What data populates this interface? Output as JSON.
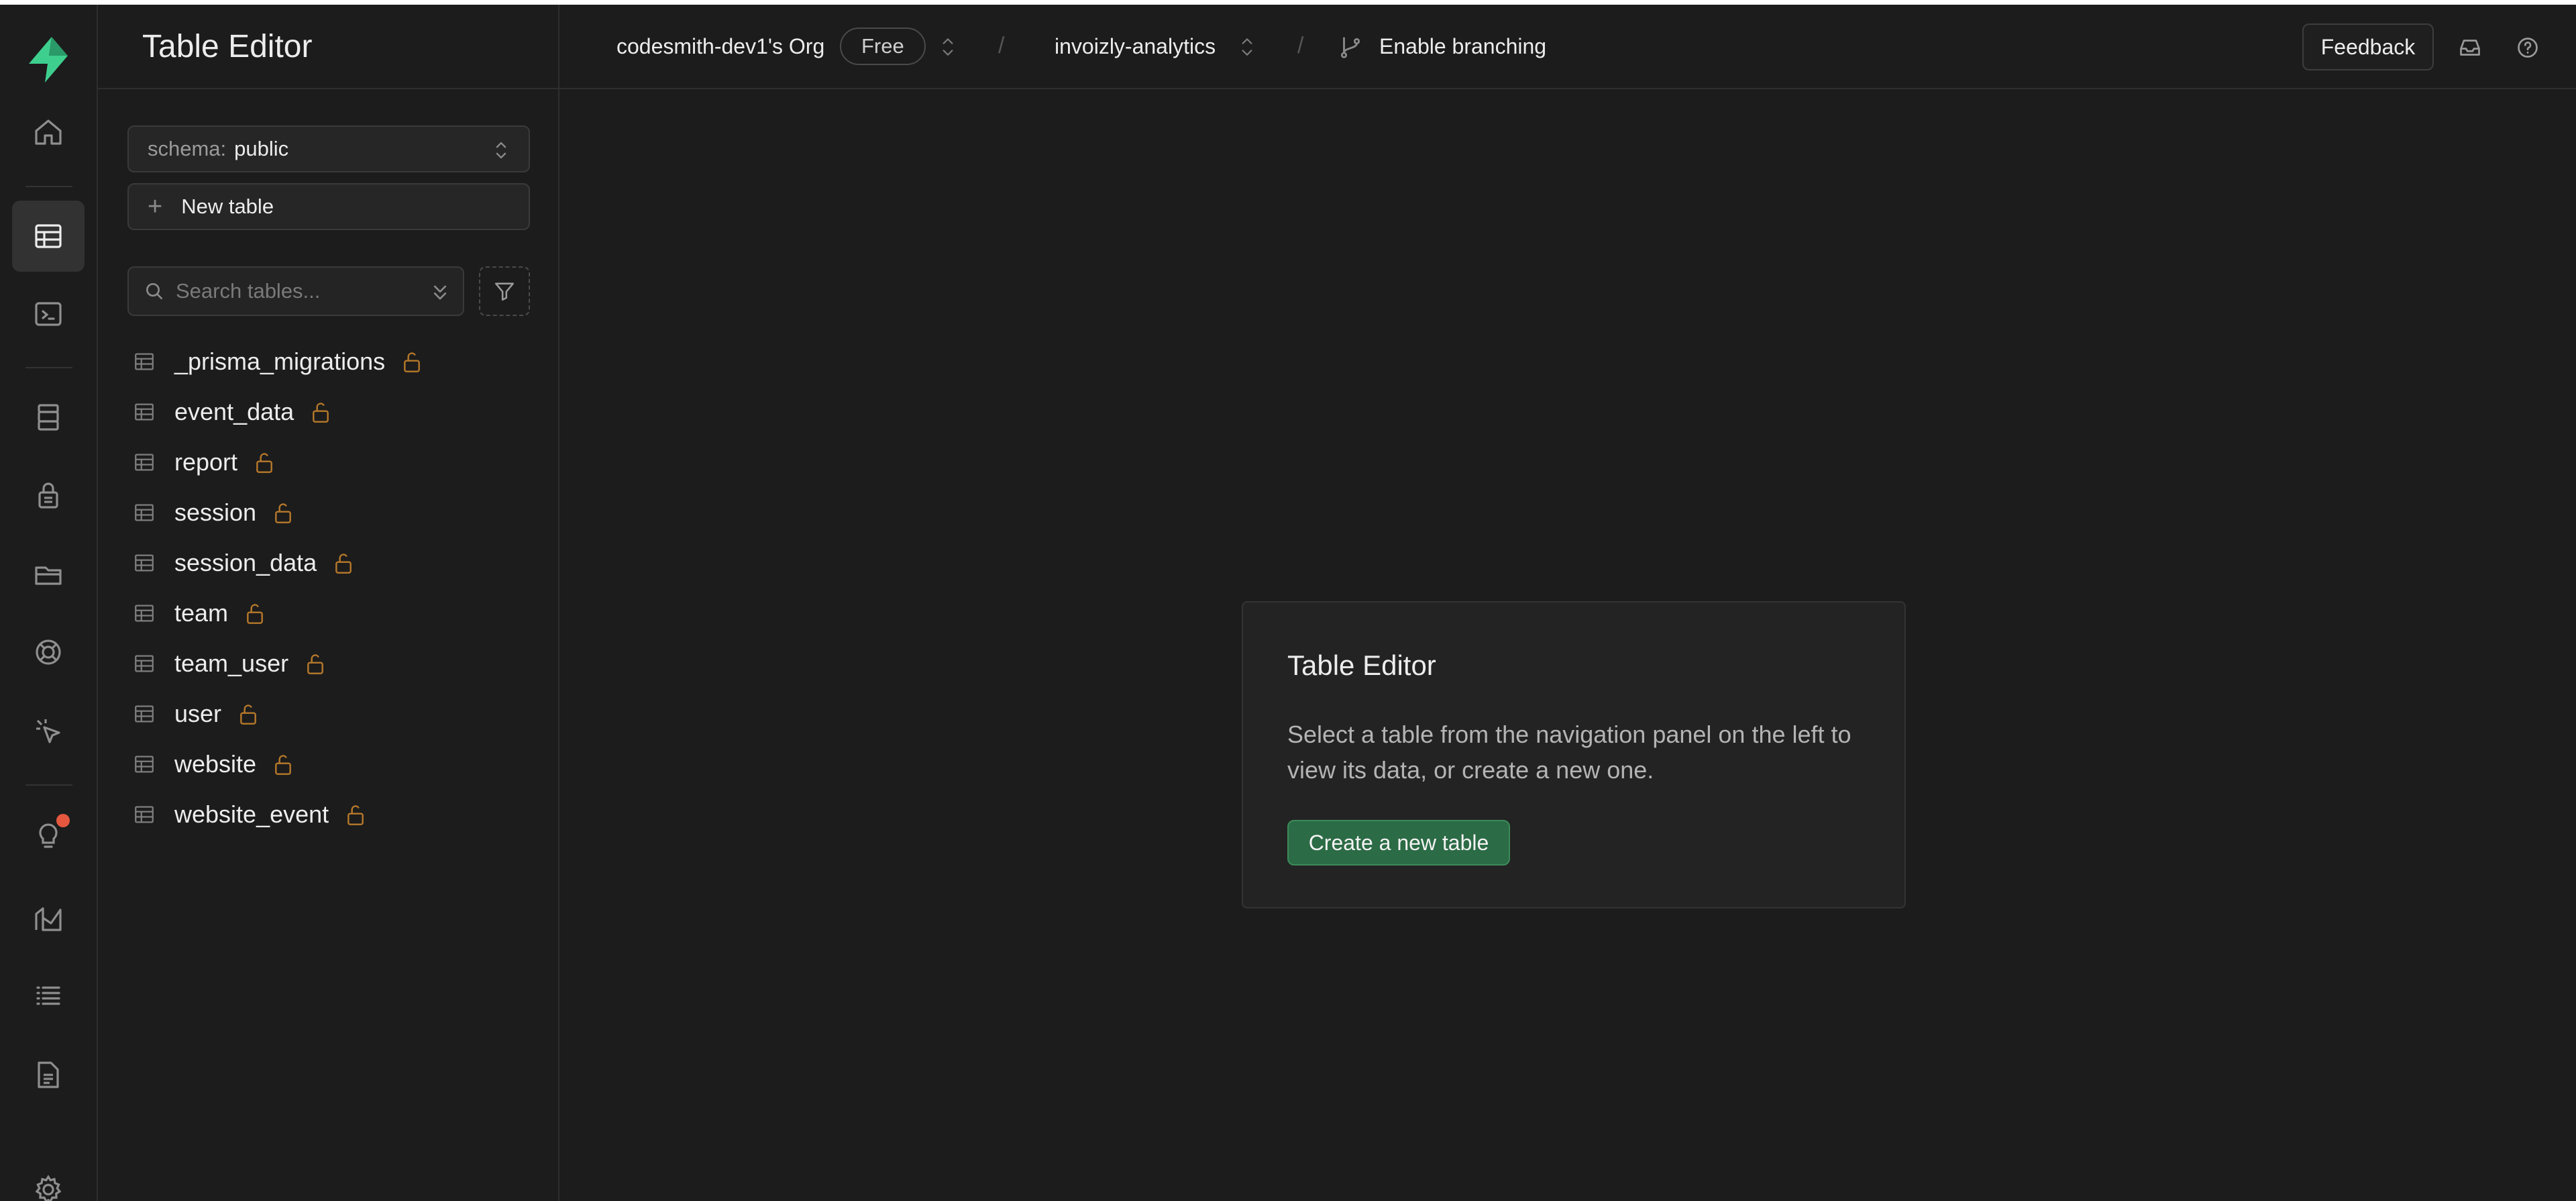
{
  "colors": {
    "brand": "#3ecf8e",
    "accent_button": "#2b6b45",
    "lock": "#b7792a",
    "notification": "#e5573f"
  },
  "rail": {
    "items": [
      {
        "name": "home",
        "icon": "home-icon"
      },
      {
        "name": "table-editor",
        "icon": "table-icon",
        "active": true
      },
      {
        "name": "sql-editor",
        "icon": "terminal-icon"
      },
      {
        "name": "database",
        "icon": "database-icon"
      },
      {
        "name": "authentication",
        "icon": "lock-icon"
      },
      {
        "name": "storage",
        "icon": "folder-icon"
      },
      {
        "name": "realtime",
        "icon": "lifebuoy-icon"
      },
      {
        "name": "edge-functions",
        "icon": "cursor-icon"
      },
      {
        "name": "advisors",
        "icon": "lightbulb-icon"
      },
      {
        "name": "reports",
        "icon": "chart-icon"
      },
      {
        "name": "logs",
        "icon": "list-icon"
      },
      {
        "name": "api-docs",
        "icon": "document-icon"
      },
      {
        "name": "settings",
        "icon": "gear-icon"
      }
    ]
  },
  "sidebar": {
    "title": "Table Editor",
    "schema": {
      "label": "schema:",
      "value": "public"
    },
    "new_table_label": "New table",
    "search": {
      "placeholder": "Search tables..."
    },
    "tables": [
      {
        "name": "_prisma_migrations"
      },
      {
        "name": "event_data"
      },
      {
        "name": "report"
      },
      {
        "name": "session"
      },
      {
        "name": "session_data"
      },
      {
        "name": "team"
      },
      {
        "name": "team_user"
      },
      {
        "name": "user"
      },
      {
        "name": "website"
      },
      {
        "name": "website_event"
      }
    ]
  },
  "topbar": {
    "org_name": "codesmith-dev1's Org",
    "plan_badge": "Free",
    "project_name": "invoizly-analytics",
    "branching_label": "Enable branching",
    "feedback_label": "Feedback"
  },
  "main": {
    "card_title": "Table Editor",
    "card_description": "Select a table from the navigation panel on the left to view its data, or create a new one.",
    "create_button_label": "Create a new table"
  }
}
